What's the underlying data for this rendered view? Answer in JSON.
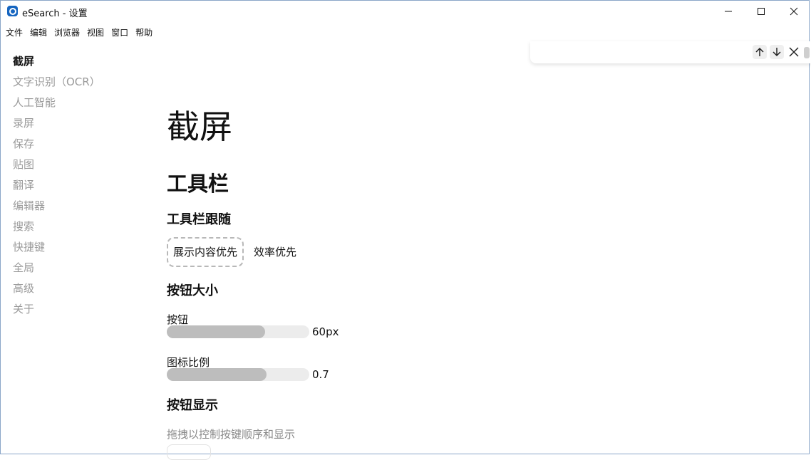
{
  "window": {
    "title": "eSearch - 设置",
    "app_icon": "esearch-logo-icon",
    "controls": [
      "minimize-icon",
      "maximize-icon",
      "close-icon"
    ]
  },
  "menubar": {
    "items": [
      "文件",
      "编辑",
      "浏览器",
      "视图",
      "窗口",
      "帮助"
    ]
  },
  "sidebar": {
    "items": [
      {
        "label": "截屏",
        "active": true
      },
      {
        "label": "文字识别（OCR）"
      },
      {
        "label": "人工智能"
      },
      {
        "label": "录屏"
      },
      {
        "label": "保存"
      },
      {
        "label": "贴图"
      },
      {
        "label": "翻译"
      },
      {
        "label": "编辑器"
      },
      {
        "label": "搜索"
      },
      {
        "label": "快捷键"
      },
      {
        "label": "全局"
      },
      {
        "label": "高级"
      },
      {
        "label": "关于"
      }
    ]
  },
  "findbar": {
    "buttons": [
      "arrow-up-icon",
      "arrow-down-icon",
      "close-icon"
    ]
  },
  "main": {
    "page_title": "截屏",
    "section_title": "工具栏",
    "follow": {
      "heading": "工具栏跟随",
      "options": [
        "展示内容优先",
        "效率优先"
      ],
      "selected": "展示内容优先"
    },
    "button_size": {
      "heading": "按钮大小",
      "button_label": "按钮",
      "button_value": "60px",
      "button_fill": 0.69,
      "icon_label": "图标比例",
      "icon_value": "0.7",
      "icon_fill": 0.7
    },
    "button_display": {
      "heading": "按钮显示",
      "hint": "拖拽以控制按键顺序和显示"
    }
  },
  "colors": {
    "accent": "#1565c0",
    "muted_text": "#9a9a9a",
    "slider_fill": "#bdbdbd",
    "slider_track": "#ececec"
  }
}
